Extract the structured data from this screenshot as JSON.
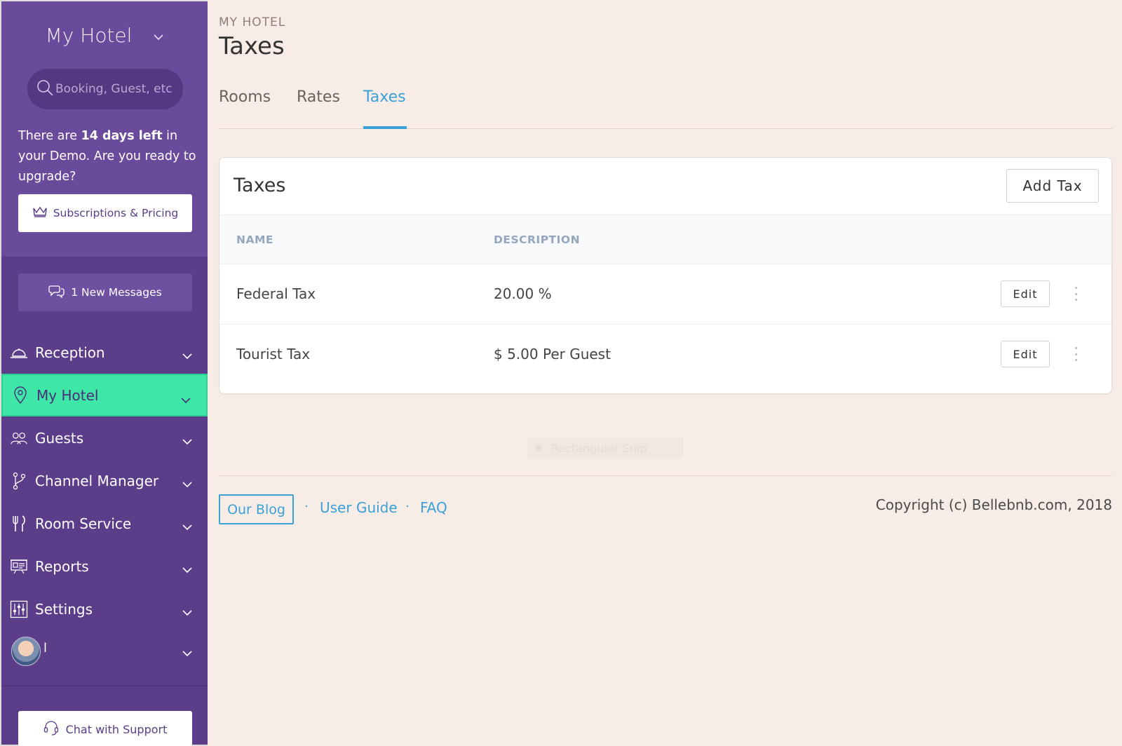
{
  "sidebar": {
    "hotel_name": "My Hotel",
    "search_placeholder": "Booking, Guest, etc",
    "demo": {
      "prefix": "There are ",
      "highlight": "14 days left",
      "suffix": " in your Demo. Are you ready to upgrade?"
    },
    "subscriptions_label": "Subscriptions & Pricing",
    "messages_label": "1 New Messages",
    "nav": [
      {
        "label": "Reception",
        "icon": "bell-icon"
      },
      {
        "label": "My Hotel",
        "icon": "location-pin-icon",
        "active": true
      },
      {
        "label": "Guests",
        "icon": "users-icon"
      },
      {
        "label": "Channel Manager",
        "icon": "branch-icon"
      },
      {
        "label": "Room Service",
        "icon": "fork-knife-icon"
      },
      {
        "label": "Reports",
        "icon": "presentation-icon"
      },
      {
        "label": "Settings",
        "icon": "sliders-icon"
      }
    ],
    "user_name": "l",
    "chat_label": "Chat with Support"
  },
  "header": {
    "breadcrumb": "MY HOTEL",
    "title": "Taxes"
  },
  "tabs": [
    {
      "label": "Rooms",
      "active": false
    },
    {
      "label": "Rates",
      "active": false
    },
    {
      "label": "Taxes",
      "active": true
    }
  ],
  "taxes_card": {
    "title": "Taxes",
    "add_label": "Add Tax",
    "columns": [
      "NAME",
      "DESCRIPTION"
    ],
    "rows": [
      {
        "name": "Federal Tax",
        "description": "20.00 %",
        "edit": "Edit"
      },
      {
        "name": "Tourist Tax",
        "description": "$ 5.00 Per Guest",
        "edit": "Edit"
      }
    ]
  },
  "overlay_text": "Rectangular Snip",
  "footer": {
    "blog_label": "Our Blog",
    "separator": "·",
    "user_guide": "User Guide",
    "faq": "FAQ",
    "copyright": "Copyright (c) Bellebnb.com, 2018"
  },
  "colors": {
    "sidebar_bg": "#5b3d8a",
    "active_nav": "#3ee6a8",
    "accent_blue": "#3aa0d8",
    "page_bg": "#f7ede6"
  }
}
